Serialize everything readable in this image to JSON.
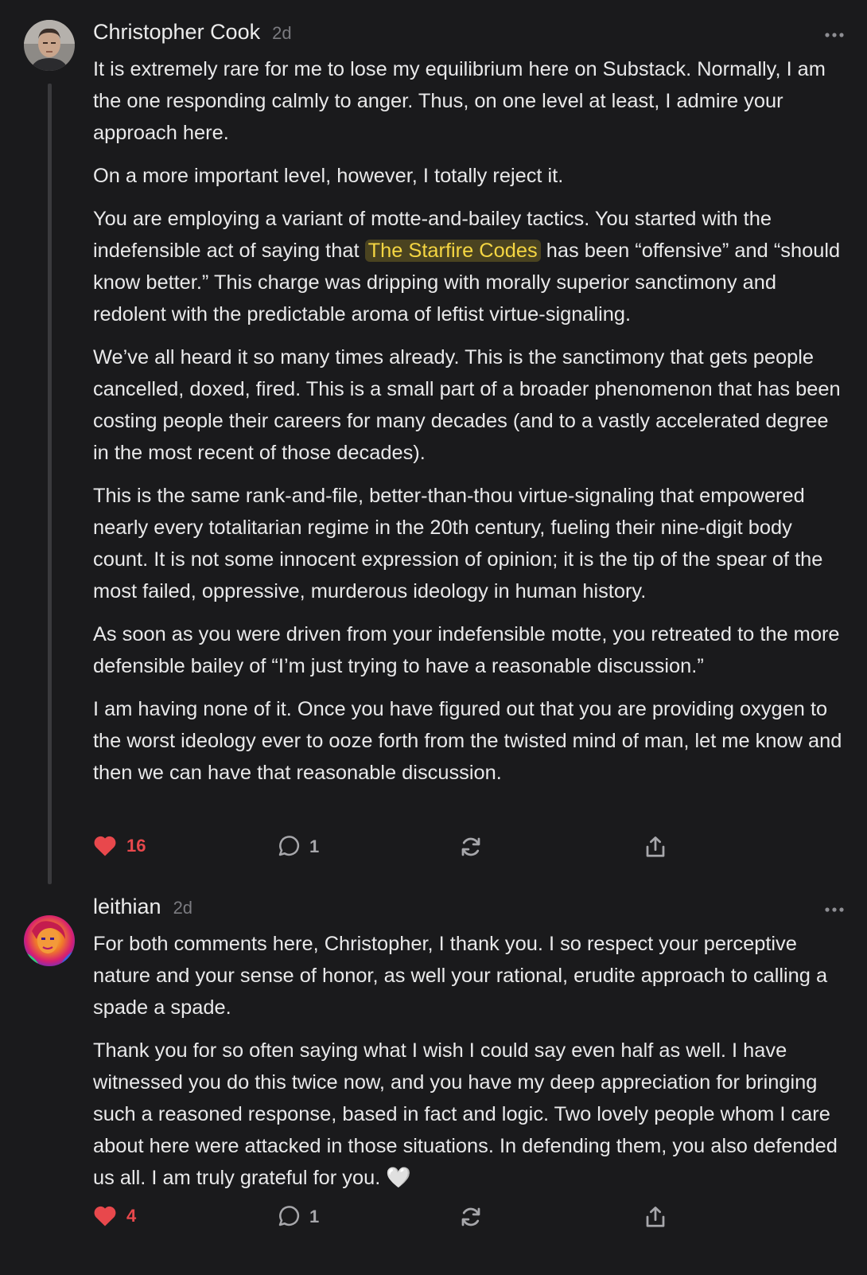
{
  "comments": [
    {
      "author": "Christopher Cook",
      "time": "2d",
      "paragraphs": [
        "It is extremely rare for me to lose my equilibrium here on Substack. Normally, I am the one responding calmly to anger. Thus, on one level at least, I admire your approach here.",
        "On a more important level, however, I totally reject it.",
        {
          "before": "You are employing a variant of motte-and-bailey tactics. You started with the indefensible act of saying that ",
          "mention": "The Starfire Codes",
          "after": " has been “offensive” and “should know better.” This charge was dripping with morally superior sanctimony and redolent with the predictable aroma of leftist virtue-signaling."
        },
        "We’ve all heard it so many times already. This is the sanctimony that gets people cancelled, doxed, fired. This is a small part of a broader phenomenon that has been costing people their careers for many decades (and to a vastly accelerated degree in the most recent of those decades).",
        "This is the same rank-and-file, better-than-thou virtue-signaling that empowered nearly every totalitarian regime in the 20th century, fueling their nine-digit body count. It is not some innocent expression of opinion; it is the tip of the spear of the most failed, oppressive, murderous ideology in human history.",
        "As soon as you were driven from your indefensible motte, you retreated to the more defensible bailey of “I’m just trying to have a reasonable discussion.”",
        "I am having none of it. Once you have figured out that you are providing oxygen to the worst ideology ever to ooze forth from the twisted mind of man, let me know and then we can have that reasonable discussion."
      ],
      "likes": "16",
      "replies": "1"
    },
    {
      "author": "leithian",
      "time": "2d",
      "paragraphs": [
        "For both comments here, Christopher, I thank you. I so respect your perceptive nature and your sense of honor, as well your rational, erudite approach to calling a spade a spade.",
        "Thank you for so often saying what I wish I could say even half as well. I have witnessed you do this twice now, and you have my deep appreciation for bringing such a reasoned response, based in fact and logic. Two lovely people whom I care about here were attacked in those situations. In defending them, you also defended us all. I am truly grateful for you. 🤍"
      ],
      "likes": "4",
      "replies": "1"
    }
  ],
  "colors": {
    "background": "#1a1a1c",
    "like": "#e8484c",
    "mention": "#f5d642",
    "muted": "#7b7b80"
  },
  "icons": [
    "heart-icon",
    "comment-bubble-icon",
    "restack-icon",
    "share-icon",
    "more-icon"
  ]
}
